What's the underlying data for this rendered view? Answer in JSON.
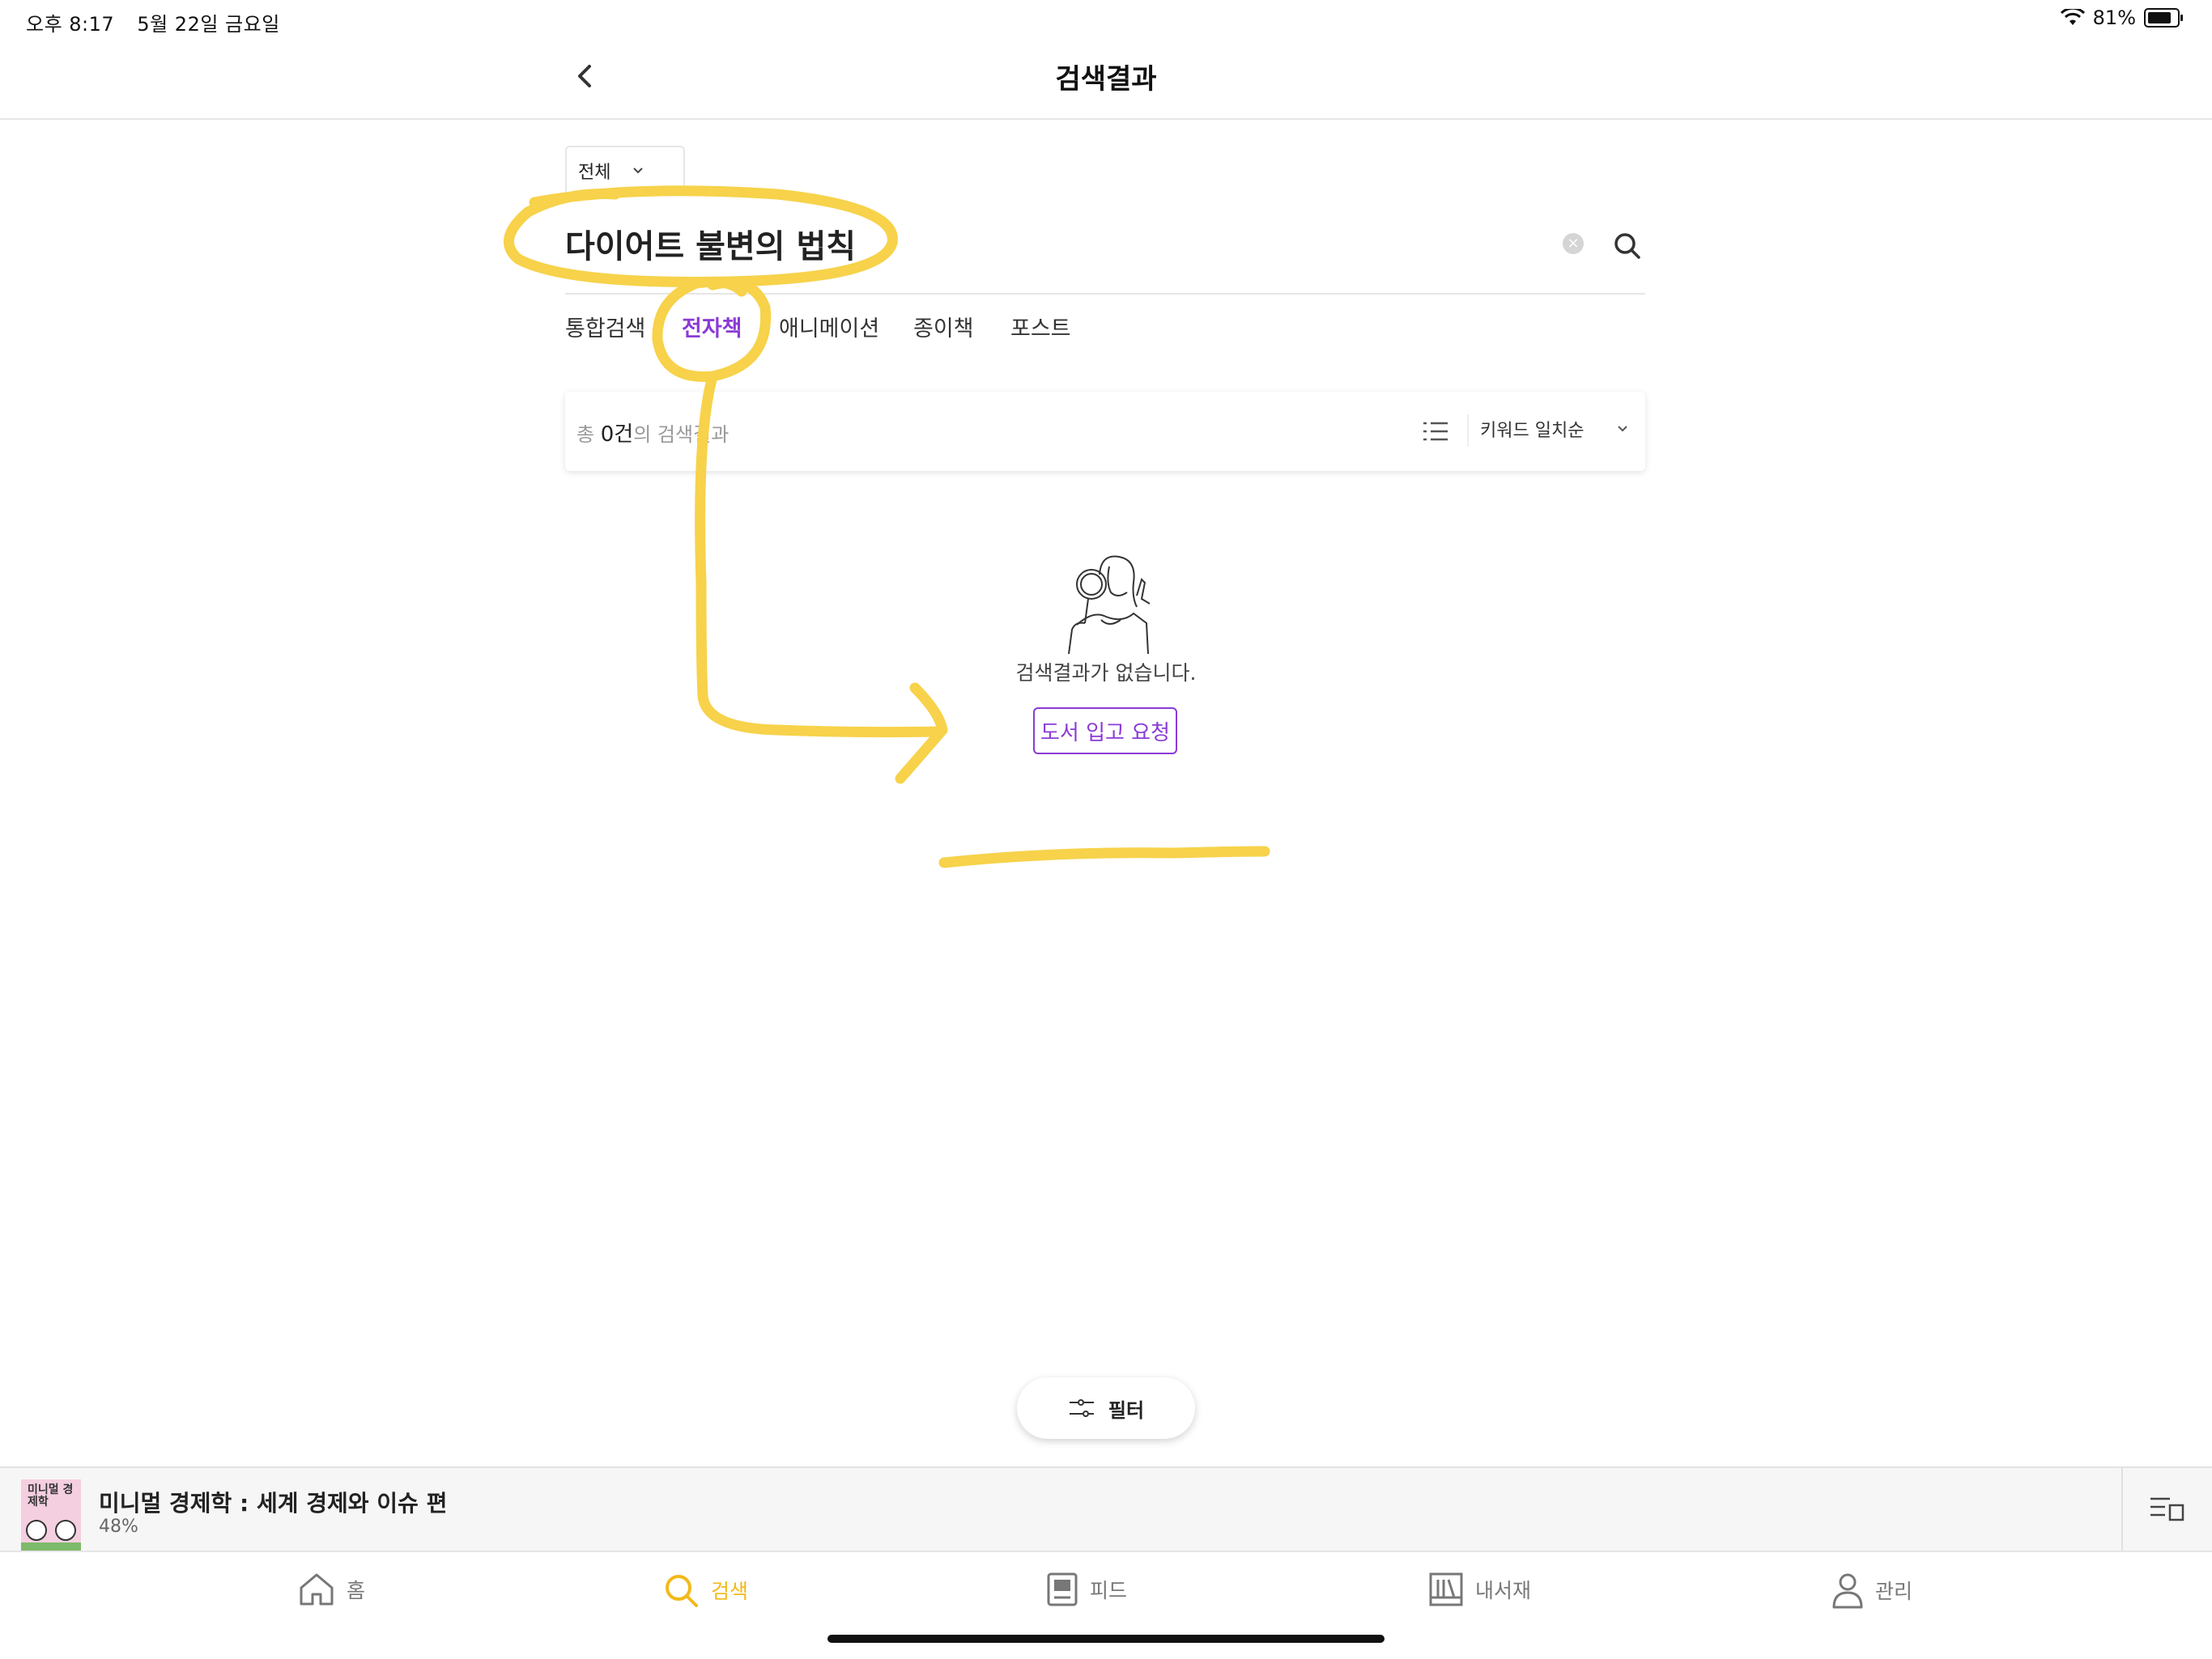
{
  "status": {
    "time": "오후 8:17",
    "date": "5월 22일 금요일",
    "battery": "81%",
    "battery_level": 0.81
  },
  "header": {
    "title": "검색결과"
  },
  "search": {
    "scope": "전체",
    "query": "다이어트 불변의 법칙",
    "tabs": [
      "통합검색",
      "전자책",
      "애니메이션",
      "종이책",
      "포스트"
    ],
    "active_tab": "전자책"
  },
  "results": {
    "prefix": "총 ",
    "count": "0건",
    "suffix": "의 검색결과",
    "sort": "키워드 일치순"
  },
  "empty": {
    "message": "검색결과가 없습니다.",
    "request_button": "도서 입고 요청"
  },
  "filter": {
    "label": "필터"
  },
  "now_reading": {
    "title": "미니멀 경제학 : 세계 경제와 이슈 편",
    "progress": "48%",
    "cover_text": "미니멀 경제학"
  },
  "tabbar": {
    "home": "홈",
    "search": "검색",
    "feed": "피드",
    "library": "내서재",
    "manage": "관리"
  },
  "colors": {
    "accent_purple": "#8a3bd6",
    "tab_active_yellow": "#f2b91a",
    "annotation": "#f7d24a"
  }
}
